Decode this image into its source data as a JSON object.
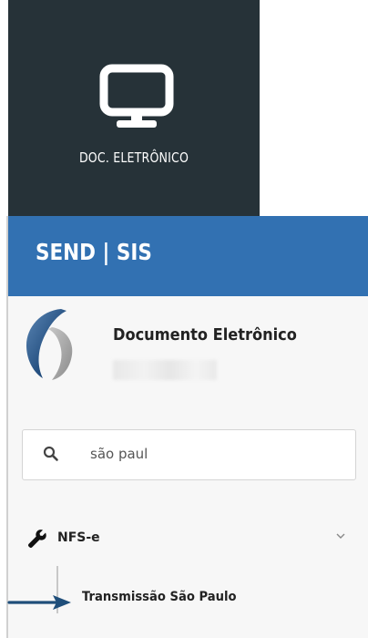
{
  "tile": {
    "label": "DOC. ELETRÔNICO",
    "icon": "monitor-icon",
    "bg_color": "#263238"
  },
  "brand": {
    "title": "SEND | SIS",
    "bg_color": "#3271b2"
  },
  "user": {
    "name": "Documento Eletrônico",
    "logo": "company-logo"
  },
  "search": {
    "icon": "search-icon",
    "value": "são paul"
  },
  "menu": {
    "item": {
      "label": "NFS-e",
      "icon": "wrench-icon",
      "expand_icon": "chevron-down-icon"
    },
    "subitem": {
      "label": "Transmissão São Paulo"
    }
  },
  "annotation": {
    "arrow_color": "#1f4e7a"
  }
}
